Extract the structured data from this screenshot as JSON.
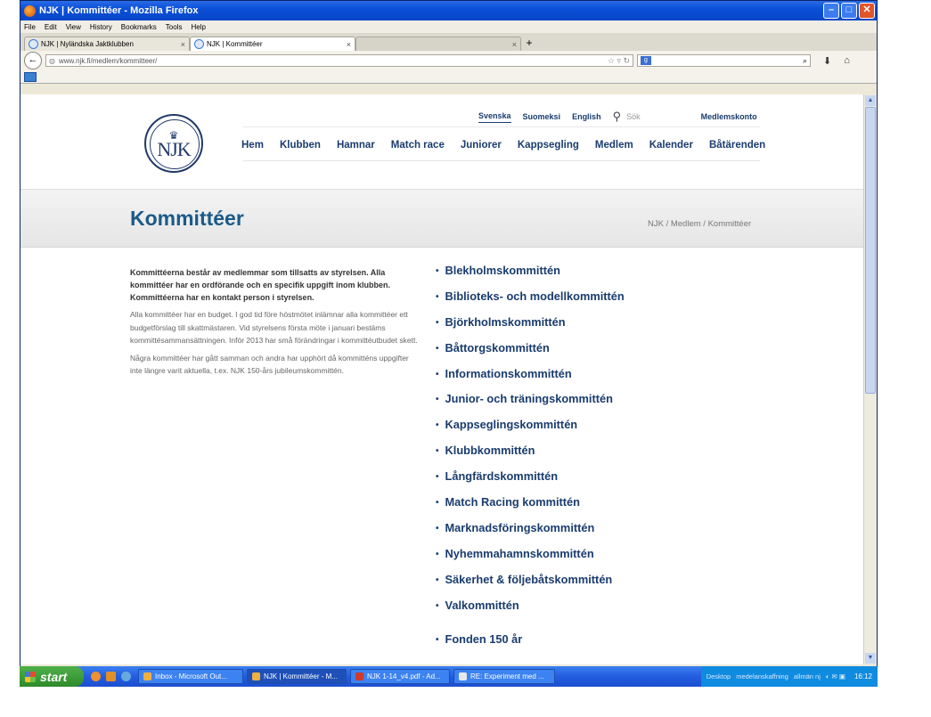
{
  "browser": {
    "window_title": "NJK | Kommittéer - Mozilla Firefox",
    "menu": [
      "File",
      "Edit",
      "View",
      "History",
      "Bookmarks",
      "Tools",
      "Help"
    ],
    "tabs": [
      {
        "label": "NJK | Nyländska Jaktklubben"
      },
      {
        "label": "NJK | Kommittéer"
      }
    ],
    "url": "www.njk.fi/medlem/kommitteer/"
  },
  "site": {
    "logo_text": "NJK",
    "languages": [
      "Svenska",
      "Suomeksi",
      "English"
    ],
    "active_language": "Svenska",
    "search_placeholder": "Sök",
    "account_link": "Medlemskonto",
    "nav": [
      "Hem",
      "Klubben",
      "Hamnar",
      "Match race",
      "Juniorer",
      "Kappsegling",
      "Medlem",
      "Kalender",
      "Båtärenden"
    ]
  },
  "page": {
    "title": "Kommittéer",
    "breadcrumb": "NJK / Medlem / Kommittéer",
    "intro_lead": "Kommittéerna består av medlemmar som tillsatts av styrelsen. Alla kommittéer har en ordförande och en specifik uppgift inom klubben. Kommittéerna har en kontakt person i styrelsen.",
    "intro_p1": "Alla kommittéer har en budget. I god tid före höstmötet inlämnar alla kommittéer ett budgetförslag till skattmästaren. Vid styrelsens första möte i januari bestäms kommittésammansättningen. Inför 2013 har små förändringar i kommittéutbudet skett.",
    "intro_p2": "Några kommittéer har gått samman och andra har upphört då kommitténs uppgifter inte längre varit aktuella, t.ex. NJK 150-års jubileumskommittén.",
    "committees": [
      "Blekholmskommittén",
      "Biblioteks- och modellkommittén",
      "Björkholmskommittén",
      "Båttorgskommittén",
      "Informationskommittén",
      "Junior- och träningskommittén",
      "Kappseglingskommittén",
      "Klubbkommittén",
      "Långfärdskommittén",
      "Match Racing kommittén",
      "Marknadsföringskommittén",
      "Nyhemmahamnskommittén",
      "Säkerhet & följebåtskommittén",
      "Valkommittén",
      "Fonden 150 år"
    ]
  },
  "taskbar": {
    "start": "start",
    "buttons": [
      "Inbox - Microsoft Out...",
      "NJK | Kommittéer - M...",
      "NJK 1-14_v4.pdf - Ad...",
      "RE: Experiment med ..."
    ],
    "tray_items": [
      "Desktop",
      "medelanskaffning",
      "allmän nj"
    ],
    "clock": "16:12"
  }
}
